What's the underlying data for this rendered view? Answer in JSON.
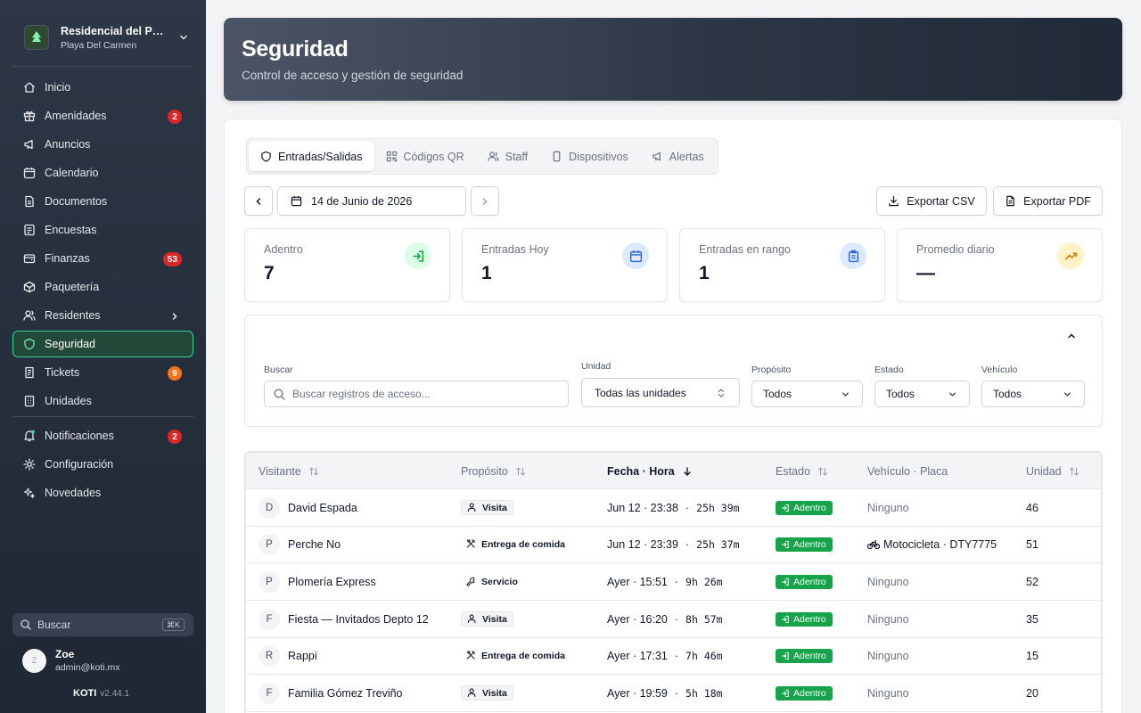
{
  "sidebar": {
    "org_name": "Residencial del Pa...",
    "org_location": "Playa Del Carmen",
    "items": [
      {
        "label": "Inicio",
        "icon": "home-icon"
      },
      {
        "label": "Amenidades",
        "icon": "gift-icon",
        "badge": "2"
      },
      {
        "label": "Anuncios",
        "icon": "megaphone-icon"
      },
      {
        "label": "Calendario",
        "icon": "calendar-icon"
      },
      {
        "label": "Documentos",
        "icon": "document-icon"
      },
      {
        "label": "Encuestas",
        "icon": "survey-icon"
      },
      {
        "label": "Finanzas",
        "icon": "wallet-icon",
        "badge": "53"
      },
      {
        "label": "Paquetería",
        "icon": "package-icon"
      },
      {
        "label": "Residentes",
        "icon": "users-icon"
      },
      {
        "label": "Seguridad",
        "icon": "shield-icon",
        "active": true
      },
      {
        "label": "Tickets",
        "icon": "ticket-icon",
        "badge": "9"
      },
      {
        "label": "Unidades",
        "icon": "building-icon"
      }
    ],
    "items2": [
      {
        "label": "Notificaciones",
        "icon": "bell-icon",
        "badge": "2"
      },
      {
        "label": "Configuración",
        "icon": "gear-icon"
      },
      {
        "label": "Novedades",
        "icon": "sparkles-icon"
      }
    ],
    "search_label": "Buscar",
    "search_shortcut": "⌘K",
    "user": {
      "initial": "Z",
      "name": "Zoe",
      "email": "admin@koti.mx"
    },
    "brand": "KOTI",
    "version": "v2.44.1",
    "colors": {
      "accent": "#34d399",
      "badge": "#dc2626",
      "badge_warn": "#f97316"
    }
  },
  "header": {
    "title": "Seguridad",
    "subtitle": "Control de acceso y gestión de seguridad"
  },
  "tabs": [
    {
      "label": "Entradas/Salidas",
      "icon": "shield-icon",
      "active": true
    },
    {
      "label": "Códigos QR",
      "icon": "qr-code-icon"
    },
    {
      "label": "Staff",
      "icon": "users-icon"
    },
    {
      "label": "Dispositivos",
      "icon": "device-icon"
    },
    {
      "label": "Alertas",
      "icon": "megaphone-icon"
    }
  ],
  "date_nav": {
    "date": "14 de Junio de 2026"
  },
  "export": {
    "csv": "Exportar CSV",
    "pdf": "Exportar PDF"
  },
  "stats": [
    {
      "label": "Adentro",
      "value": "7",
      "icon": "login-icon",
      "color": "#dcfce7"
    },
    {
      "label": "Entradas Hoy",
      "value": "1",
      "icon": "calendar-icon",
      "color": "#dbeafe"
    },
    {
      "label": "Entradas en rango",
      "value": "1",
      "icon": "clipboard-icon",
      "color": "#dbeafe"
    },
    {
      "label": "Promedio diario",
      "value": "—",
      "icon": "trending-up-icon",
      "color": "#fef3c7"
    }
  ],
  "filters": {
    "search_label": "Buscar",
    "search_placeholder": "Buscar registros de acceso...",
    "unit_label": "Unidad",
    "unit_value": "Todas las unidades",
    "purpose_label": "Propósito",
    "purpose_value": "Todos",
    "status_label": "Estado",
    "status_value": "Todos",
    "vehicle_label": "Vehículo",
    "vehicle_value": "Todos"
  },
  "table": {
    "columns": [
      "Visitante",
      "Propósito",
      "Fecha · Hora",
      "Estado",
      "Vehículo · Placa",
      "Unidad"
    ],
    "rows": [
      {
        "initial": "D",
        "visitor": "David Espada",
        "purpose": "Visita",
        "purpose_icon": "person-icon",
        "datetime": "Jun 12 · 23:38",
        "duration": "25h 39m",
        "status": "Adentro",
        "vehicle": "Ninguno",
        "has_vehicle": false,
        "unit": "46"
      },
      {
        "initial": "P",
        "visitor": "Perche No",
        "purpose": "Entrega de comida",
        "purpose_icon": "utensils-icon",
        "datetime": "Jun 12 · 23:39",
        "duration": "25h 37m",
        "status": "Adentro",
        "vehicle": "Motocicleta · DTY7775",
        "has_vehicle": true,
        "unit": "51"
      },
      {
        "initial": "P",
        "visitor": "Plomería Express",
        "purpose": "Servicio",
        "purpose_icon": "wrench-icon",
        "datetime": "Ayer · 15:51",
        "duration": "9h 26m",
        "status": "Adentro",
        "vehicle": "Ninguno",
        "has_vehicle": false,
        "unit": "52"
      },
      {
        "initial": "F",
        "visitor": "Fiesta — Invitados Depto 12",
        "purpose": "Visita",
        "purpose_icon": "person-icon",
        "datetime": "Ayer · 16:20",
        "duration": "8h 57m",
        "status": "Adentro",
        "vehicle": "Ninguno",
        "has_vehicle": false,
        "unit": "35"
      },
      {
        "initial": "R",
        "visitor": "Rappi",
        "purpose": "Entrega de comida",
        "purpose_icon": "utensils-icon",
        "datetime": "Ayer · 17:31",
        "duration": "7h 46m",
        "status": "Adentro",
        "vehicle": "Ninguno",
        "has_vehicle": false,
        "unit": "15"
      },
      {
        "initial": "F",
        "visitor": "Familia Gómez Treviño",
        "purpose": "Visita",
        "purpose_icon": "person-icon",
        "datetime": "Ayer · 19:59",
        "duration": "5h 18m",
        "status": "Adentro",
        "vehicle": "Ninguno",
        "has_vehicle": false,
        "unit": "20"
      }
    ]
  }
}
